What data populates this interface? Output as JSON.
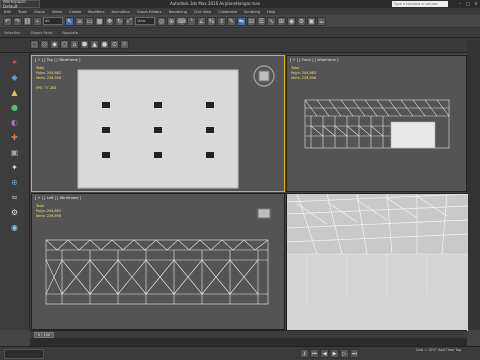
{
  "window": {
    "workspace": "Workspace: Default",
    "title": "Autodesk 3ds Max 2016  AirplaneHangar.max",
    "search_placeholder": "Type a keyword or phrase"
  },
  "menu": {
    "items": [
      "Edit",
      "Tools",
      "Group",
      "Views",
      "Create",
      "Modifiers",
      "Animation",
      "Graph Editors",
      "Rendering",
      "Civil View",
      "Customize",
      "Scripting",
      "Help"
    ]
  },
  "toolbar": {
    "filter_value": "All",
    "view_value": "View"
  },
  "ribbon": {
    "tabs": [
      "Selection",
      "Object Paint",
      "Populate"
    ]
  },
  "viewports": {
    "top": {
      "label": "[ + ] [ Top ] [ Wireframe ]",
      "stats": [
        "Total",
        "Polys:  204,863",
        "Verts:  226,996",
        "",
        "FPS:    77.283"
      ]
    },
    "front": {
      "label": "[ + ] [ Front ] [ Wireframe ]",
      "stats": [
        "Total",
        "Polys:  204,863",
        "Verts:  226,996"
      ]
    },
    "left": {
      "label": "[ + ] [ Left ] [ Wireframe ]",
      "stats": [
        "Total",
        "Polys:  204,863",
        "Verts:  226,996"
      ]
    },
    "persp": {
      "label": ""
    }
  },
  "timeline": {
    "frame": "0 / 100"
  },
  "status": {
    "coords": "Grid = 10'0\"    Add Time Tag"
  },
  "colors": {
    "active_border": "#e0b400",
    "stats_text": "#ffe36e",
    "viewport_bg": "#545454"
  }
}
